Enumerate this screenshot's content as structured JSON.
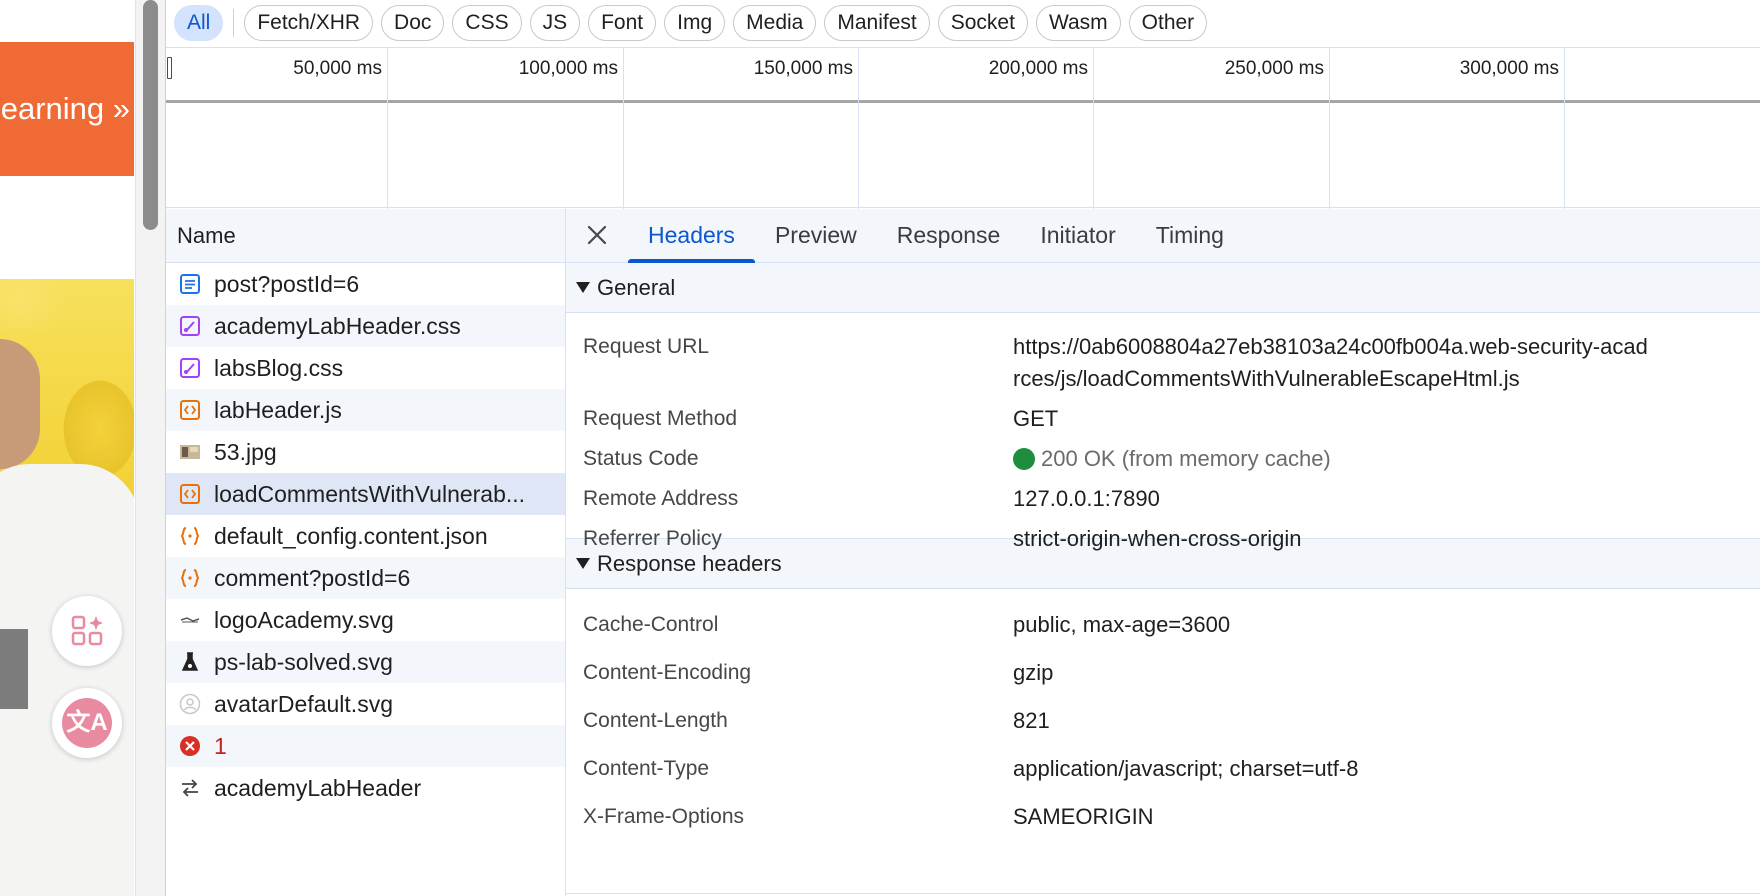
{
  "page": {
    "cta_label": "earning »",
    "fab_translate_label": "文A"
  },
  "filters": [
    {
      "label": "All",
      "active": true
    },
    {
      "label": "Fetch/XHR"
    },
    {
      "label": "Doc"
    },
    {
      "label": "CSS"
    },
    {
      "label": "JS"
    },
    {
      "label": "Font"
    },
    {
      "label": "Img"
    },
    {
      "label": "Media"
    },
    {
      "label": "Manifest"
    },
    {
      "label": "Socket"
    },
    {
      "label": "Wasm"
    },
    {
      "label": "Other"
    }
  ],
  "overview": {
    "ticks": [
      "50,000 ms",
      "100,000 ms",
      "150,000 ms",
      "200,000 ms",
      "250,000 ms",
      "300,000 ms"
    ]
  },
  "requests": {
    "header": "Name",
    "items": [
      {
        "name": "post?postId=6",
        "icon": "document-icon",
        "color": "#1a73e8"
      },
      {
        "name": "academyLabHeader.css",
        "icon": "stylesheet-icon",
        "color": "#a142f4"
      },
      {
        "name": "labsBlog.css",
        "icon": "stylesheet-icon",
        "color": "#a142f4"
      },
      {
        "name": "labHeader.js",
        "icon": "script-icon",
        "color": "#e8710a"
      },
      {
        "name": "53.jpg",
        "icon": "image-thumbnail-icon",
        "color": "#888888"
      },
      {
        "name": "loadCommentsWithVulnerab...",
        "icon": "script-icon",
        "color": "#e8710a",
        "selected": true
      },
      {
        "name": "default_config.content.json",
        "icon": "json-icon",
        "color": "#e8710a"
      },
      {
        "name": "comment?postId=6",
        "icon": "json-icon",
        "color": "#e8710a"
      },
      {
        "name": "logoAcademy.svg",
        "icon": "logo-thumbnail-icon",
        "color": "#555555"
      },
      {
        "name": "ps-lab-solved.svg",
        "icon": "flask-icon",
        "color": "#222222"
      },
      {
        "name": "avatarDefault.svg",
        "icon": "avatar-icon",
        "color": "#c8c8c8"
      },
      {
        "name": "1",
        "icon": "error-icon",
        "color": "#d93025",
        "error": true
      },
      {
        "name": "academyLabHeader",
        "icon": "websocket-icon",
        "color": "#444444"
      }
    ]
  },
  "detail": {
    "tabs": [
      {
        "label": "Headers",
        "active": true
      },
      {
        "label": "Preview"
      },
      {
        "label": "Response"
      },
      {
        "label": "Initiator"
      },
      {
        "label": "Timing"
      }
    ],
    "general": {
      "title": "General",
      "request_url_label": "Request URL",
      "request_url_line1": "https://0ab6008804a27eb38103a24c00fb004a.web-security-acad",
      "request_url_line2": "rces/js/loadCommentsWithVulnerableEscapeHtml.js",
      "request_method_label": "Request Method",
      "request_method": "GET",
      "status_code_label": "Status Code",
      "status_code": "200 OK (from memory cache)",
      "status_color": "#1e8e3e",
      "remote_address_label": "Remote Address",
      "remote_address": "127.0.0.1:7890",
      "referrer_policy_label": "Referrer Policy",
      "referrer_policy": "strict-origin-when-cross-origin"
    },
    "response_headers": {
      "title": "Response headers",
      "items": [
        {
          "key": "Cache-Control",
          "value": "public, max-age=3600"
        },
        {
          "key": "Content-Encoding",
          "value": "gzip"
        },
        {
          "key": "Content-Length",
          "value": "821"
        },
        {
          "key": "Content-Type",
          "value": "application/javascript; charset=utf-8"
        },
        {
          "key": "X-Frame-Options",
          "value": "SAMEORIGIN"
        }
      ]
    }
  }
}
